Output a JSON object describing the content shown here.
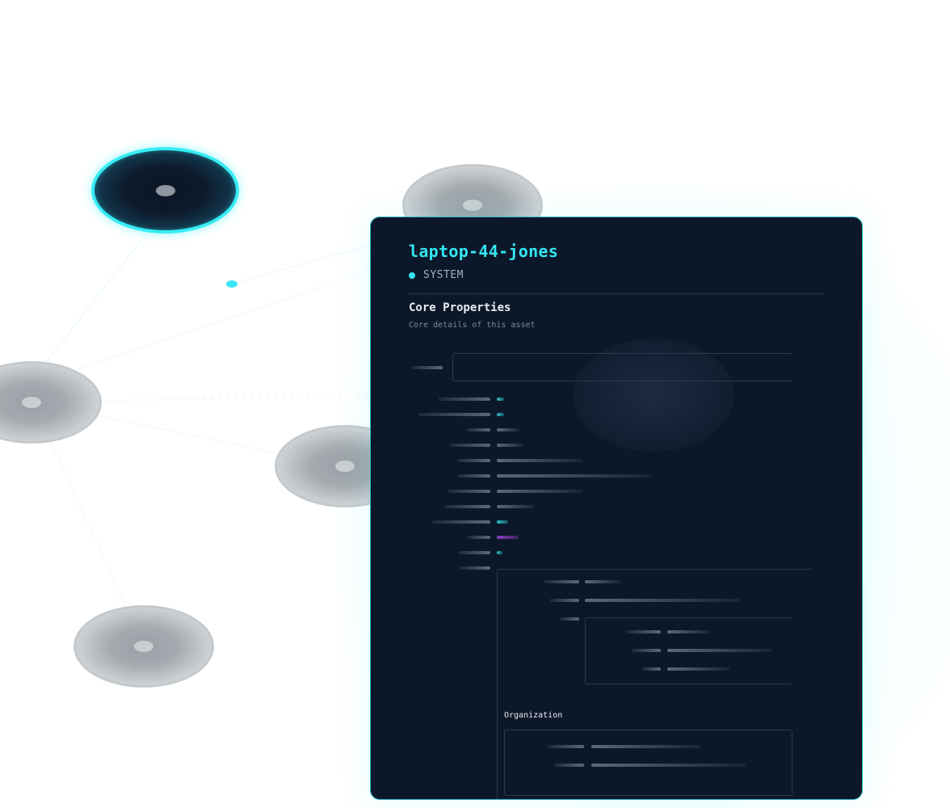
{
  "asset": {
    "name": "laptop-44-jones",
    "type": "SYSTEM"
  },
  "section": {
    "title": "Core Properties",
    "subtitle": "Core details of this asset"
  },
  "nested_section": {
    "title": "Organization"
  },
  "colors": {
    "accent": "#35e6f2",
    "panel_bg": "#0c1829",
    "secondary": "#8e3cc4"
  },
  "icons": {
    "type_indicator": "dot-icon"
  }
}
